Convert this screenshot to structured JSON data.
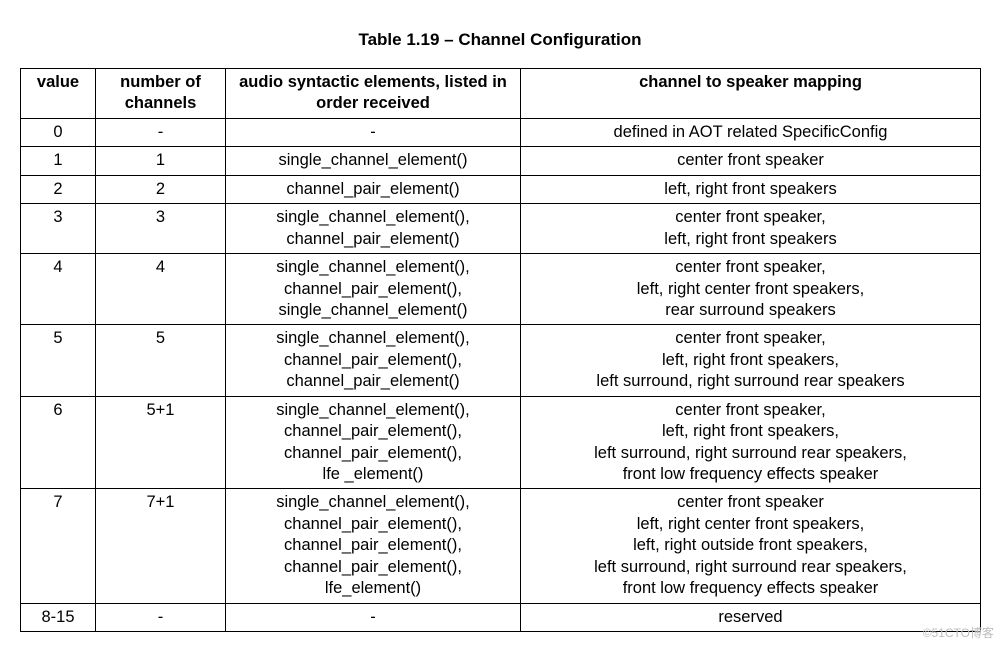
{
  "caption": "Table 1.19 – Channel Configuration",
  "headers": {
    "c1": "value",
    "c2": "number of channels",
    "c3": "audio syntactic elements, listed in order received",
    "c4": "channel to speaker mapping"
  },
  "rows": [
    {
      "value": "0",
      "channels": "-",
      "elements": [
        "-"
      ],
      "mapping": [
        "defined in AOT related SpecificConfig"
      ]
    },
    {
      "value": "1",
      "channels": "1",
      "elements": [
        "single_channel_element()"
      ],
      "mapping": [
        "center front speaker"
      ]
    },
    {
      "value": "2",
      "channels": "2",
      "elements": [
        "channel_pair_element()"
      ],
      "mapping": [
        "left, right front speakers"
      ]
    },
    {
      "value": "3",
      "channels": "3",
      "elements": [
        "single_channel_element(),",
        "channel_pair_element()"
      ],
      "mapping": [
        "center front speaker,",
        "left, right front speakers"
      ]
    },
    {
      "value": "4",
      "channels": "4",
      "elements": [
        "single_channel_element(),",
        "channel_pair_element(),",
        "single_channel_element()"
      ],
      "mapping": [
        "center front speaker,",
        "left, right center front speakers,",
        "rear surround speakers"
      ]
    },
    {
      "value": "5",
      "channels": "5",
      "elements": [
        "single_channel_element(),",
        "channel_pair_element(),",
        "channel_pair_element()"
      ],
      "mapping": [
        "center front speaker,",
        "left, right front speakers,",
        "left surround, right surround rear speakers"
      ]
    },
    {
      "value": "6",
      "channels": "5+1",
      "elements": [
        "single_channel_element(),",
        "channel_pair_element(),",
        "channel_pair_element(),",
        "lfe _element()"
      ],
      "mapping": [
        "center front speaker,",
        "left, right front speakers,",
        "left surround, right surround rear speakers,",
        "front low frequency effects speaker"
      ]
    },
    {
      "value": "7",
      "channels": "7+1",
      "elements": [
        "single_channel_element(),",
        "channel_pair_element(),",
        "channel_pair_element(),",
        "channel_pair_element(),",
        "lfe_element()"
      ],
      "mapping": [
        "center front speaker",
        "left, right center front speakers,",
        "left, right outside front speakers,",
        "left surround, right surround rear speakers,",
        "front low frequency effects speaker"
      ]
    },
    {
      "value": "8-15",
      "channels": "-",
      "elements": [
        "-"
      ],
      "mapping": [
        "reserved"
      ]
    }
  ],
  "watermark": "©51CTO博客"
}
